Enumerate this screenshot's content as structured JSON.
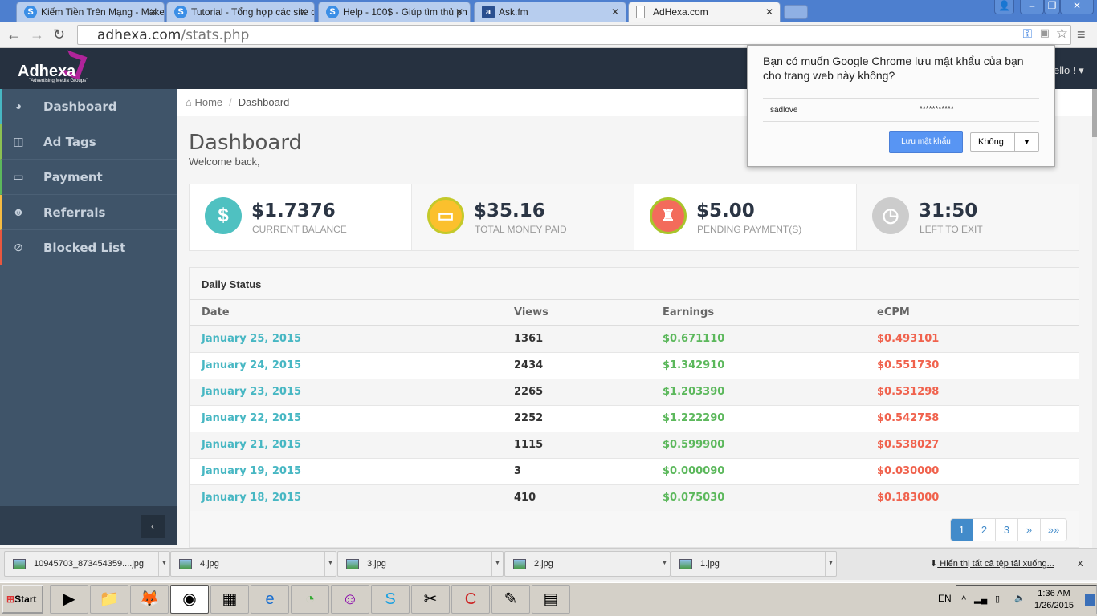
{
  "browser": {
    "tabs": [
      {
        "title": "Kiếm Tiền Trên Mạng - Make",
        "icon": "site-s-icon"
      },
      {
        "title": "Tutorial - Tổng hợp các site c",
        "icon": "site-s-icon"
      },
      {
        "title": "Help - 100$ - Giúp tìm thủ ph",
        "icon": "site-s-icon"
      },
      {
        "title": "Ask.fm",
        "icon": "askfm-icon"
      },
      {
        "title": "AdHexa.com",
        "icon": "page-icon"
      }
    ],
    "url_host": "adhexa.com",
    "url_path": "/stats.php"
  },
  "header": {
    "logo": "Adhexa",
    "tagline": "\"Advertising Media Groups\"",
    "user_menu": "ello !"
  },
  "sidebar": {
    "items": [
      {
        "label": "Dashboard",
        "icon": "dashboard-icon",
        "color": "#47b7c3"
      },
      {
        "label": "Ad Tags",
        "icon": "columns-icon",
        "color": "#8cc152"
      },
      {
        "label": "Payment",
        "icon": "credit-card-icon",
        "color": "#5cb85c"
      },
      {
        "label": "Referrals",
        "icon": "users-icon",
        "color": "#f6bb42"
      },
      {
        "label": "Blocked List",
        "icon": "eye-slash-icon",
        "color": "#e9573f"
      }
    ],
    "collapse": "‹"
  },
  "breadcrumb": {
    "home": "Home",
    "sep": "/",
    "current": "Dashboard"
  },
  "page": {
    "title": "Dashboard",
    "subtitle": "Welcome back,"
  },
  "stats": [
    {
      "value": "$1.7376",
      "label": "CURRENT BALANCE",
      "color": "#4fc1c1",
      "glyph": "$"
    },
    {
      "value": "$35.16",
      "label": "TOTAL MONEY PAID",
      "color": "#fbc02d",
      "glyph": "▭"
    },
    {
      "value": "$5.00",
      "label": "PENDING PAYMENT(S)",
      "color": "#f36b5b",
      "glyph": "♜"
    },
    {
      "value": "31:50",
      "label": "LEFT TO EXIT",
      "color": "#cccccc",
      "glyph": "◷"
    }
  ],
  "daily": {
    "title": "Daily Status",
    "columns": [
      "Date",
      "Views",
      "Earnings",
      "eCPM"
    ],
    "rows": [
      [
        "January 25, 2015",
        "1361",
        "$0.671110",
        "$0.493101"
      ],
      [
        "January 24, 2015",
        "2434",
        "$1.342910",
        "$0.551730"
      ],
      [
        "January 23, 2015",
        "2265",
        "$1.203390",
        "$0.531298"
      ],
      [
        "January 22, 2015",
        "2252",
        "$1.222290",
        "$0.542758"
      ],
      [
        "January 21, 2015",
        "1115",
        "$0.599900",
        "$0.538027"
      ],
      [
        "January 19, 2015",
        "3",
        "$0.000090",
        "$0.030000"
      ],
      [
        "January 18, 2015",
        "410",
        "$0.075030",
        "$0.183000"
      ]
    ],
    "pages": [
      "1",
      "2",
      "3",
      "»",
      "»»"
    ],
    "current_page": "1"
  },
  "password_popup": {
    "question": "Bạn có muốn Google Chrome lưu mật khẩu của bạn cho trang web này không?",
    "username": "sadlove",
    "password": "***********",
    "save": "Lưu mật khẩu",
    "no": "Không"
  },
  "downloads": {
    "files": [
      "10945703_873454359....jpg",
      "4.jpg",
      "3.jpg",
      "2.jpg",
      "1.jpg"
    ],
    "show_all": "Hiển thị tất cả tệp tải xuống...",
    "close": "x"
  },
  "taskbar": {
    "start": "Start",
    "lang": "EN",
    "time": "1:36 AM",
    "date": "1/26/2015"
  }
}
